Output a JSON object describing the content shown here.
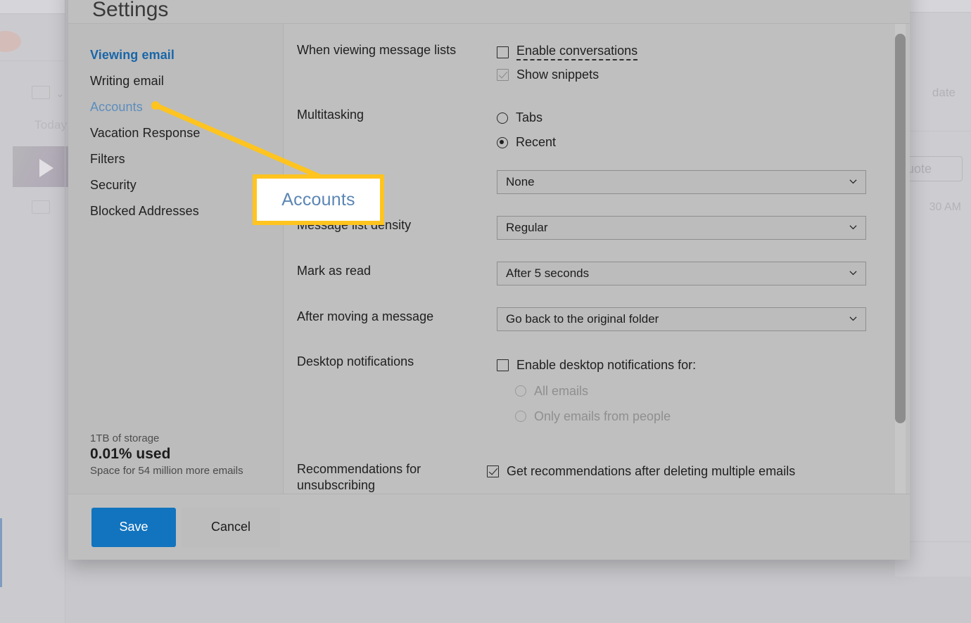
{
  "background": {
    "today_label": "Today",
    "date_label": "date",
    "quote_label": "uote",
    "time_label": "30 AM"
  },
  "modal": {
    "title": "Settings",
    "sidebar": {
      "items": [
        {
          "label": "Viewing email",
          "state": "active"
        },
        {
          "label": "Writing email",
          "state": "normal"
        },
        {
          "label": "Accounts",
          "state": "hover"
        },
        {
          "label": "Vacation Response",
          "state": "normal"
        },
        {
          "label": "Filters",
          "state": "normal"
        },
        {
          "label": "Security",
          "state": "normal"
        },
        {
          "label": "Blocked Addresses",
          "state": "normal"
        }
      ],
      "storage": {
        "total": "1TB of storage",
        "used": "0.01% used",
        "remaining": "Space for 54 million more emails"
      }
    },
    "settings": {
      "row_message_lists": {
        "label": "When viewing message lists",
        "enable_conversations": "Enable conversations",
        "show_snippets": "Show snippets"
      },
      "row_multitasking": {
        "label": "Multitasking",
        "tabs": "Tabs",
        "recent": "Recent"
      },
      "row_hidden_select": {
        "label": "",
        "value": "None"
      },
      "row_density": {
        "label": "Message list density",
        "value": "Regular"
      },
      "row_mark_read": {
        "label": "Mark as read",
        "value": "After 5 seconds"
      },
      "row_after_moving": {
        "label": "After moving a message",
        "value": "Go back to the original folder"
      },
      "row_desktop_notifications": {
        "label": "Desktop notifications",
        "enable": "Enable desktop notifications for:",
        "all_emails": "All emails",
        "only_people": "Only emails from people"
      },
      "row_recommendations": {
        "label": "Recommendations for unsubscribing",
        "checkbox": "Get recommendations after deleting multiple emails"
      }
    },
    "footer": {
      "save": "Save",
      "cancel": "Cancel"
    }
  },
  "annotation": {
    "callout_text": "Accounts",
    "highlight_color": "#ffc41f"
  }
}
